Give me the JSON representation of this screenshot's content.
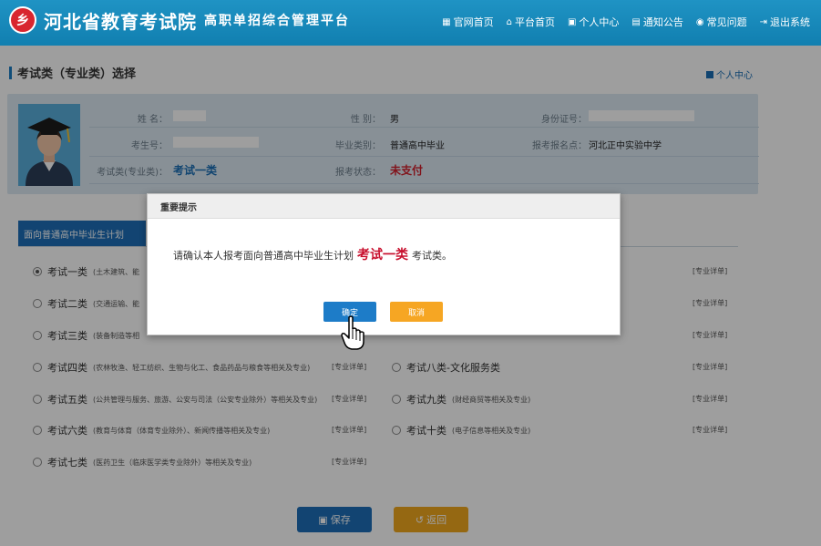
{
  "header": {
    "logo_mark": "乡",
    "title": "河北省教育考试院",
    "subtitle": "高职单招综合管理平台",
    "nav": [
      {
        "label": "官网首页",
        "icon": "home-icon"
      },
      {
        "label": "平台首页",
        "icon": "house-icon"
      },
      {
        "label": "个人中心",
        "icon": "user-icon"
      },
      {
        "label": "通知公告",
        "icon": "notice-icon"
      },
      {
        "label": "常见问题",
        "icon": "chat-icon"
      },
      {
        "label": "退出系统",
        "icon": "logout-icon"
      }
    ]
  },
  "page": {
    "title": "考试类（专业类）选择",
    "personal_center": "个人中心"
  },
  "info": {
    "name_label": "姓  名：",
    "gender_label": "性  别：",
    "gender": "男",
    "id_label": "身份证号：",
    "exam_no_label": "考生号：",
    "category_label": "毕业类别：",
    "category": "普通高中毕业",
    "site_label": "报考报名点：",
    "site": "河北正中实验中学",
    "exam_type_label": "考试类(专业类)：",
    "exam_type": "考试一类",
    "status_label": "报考状态：",
    "status": "未支付"
  },
  "category_tab": "面向普通高中毕业生计划",
  "detail_label": "[专业详单]",
  "options": [
    {
      "name": "考试一类",
      "note": "(土木建筑、能",
      "selected": true
    },
    {
      "name": "考试二类",
      "note": "(交通运输、能",
      "selected": false
    },
    {
      "name": "考试三类",
      "note": "(装备制造等相",
      "selected": false
    },
    {
      "name": "考试四类",
      "note": "(农林牧渔、轻工纺织、生物与化工、食品药品与粮食等相关及专业)",
      "selected": false
    },
    {
      "name": "考试五类",
      "note": "(公共管理与服务、旅游、公安与司法（公安专业除外）等相关及专业)",
      "selected": false
    },
    {
      "name": "考试六类",
      "note": "(教育与体育（体育专业除外）、新闻传播等相关及专业)",
      "selected": false
    },
    {
      "name": "考试七类",
      "note": "(医药卫生（临床医学类专业除外）等相关及专业)",
      "selected": false
    },
    {
      "name": "考试八类-文化服务类",
      "note": "",
      "selected": false
    },
    {
      "name": "考试九类",
      "note": "(财经商贸等相关及专业)",
      "selected": false
    },
    {
      "name": "考试十类",
      "note": "(电子信息等相关及专业)",
      "selected": false
    }
  ],
  "buttons": {
    "save": "保存",
    "back": "返回"
  },
  "modal": {
    "title": "重要提示",
    "message_before": "请确认本人报考面向普通高中毕业生计划",
    "highlight": "考试一类",
    "message_after": "考试类。",
    "ok": "确定",
    "cancel": "取消"
  },
  "colors": {
    "header": "#1485b9",
    "primary": "#1d6fb8",
    "warning": "#f0a81e",
    "highlight": "#c8102e"
  }
}
